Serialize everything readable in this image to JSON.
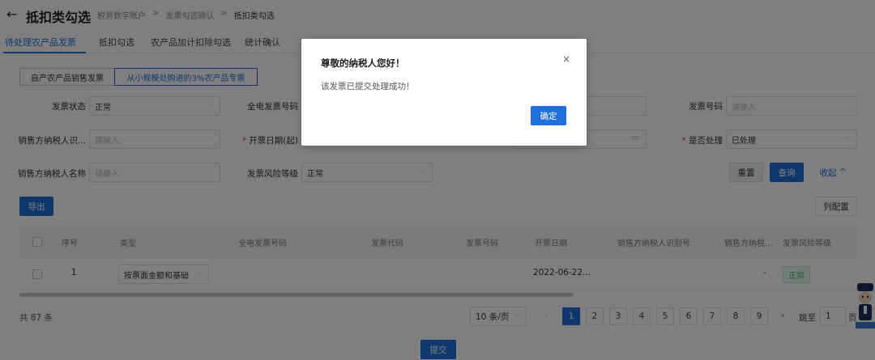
{
  "header": {
    "title": "抵扣类勾选",
    "breadcrumb": [
      "税务数字账户",
      ">",
      "发票勾选确认",
      ">",
      "抵扣类勾选"
    ]
  },
  "tabs": [
    "待处理农产品发票",
    "抵扣勾选",
    "农产品加计扣除勾选",
    "统计确认"
  ],
  "segments": [
    "自产农产品销售发票",
    "从小规模处购进的3%农产品专票"
  ],
  "filters": {
    "invoice_status_label": "发票状态",
    "invoice_status_value": "正常",
    "digital_no_label": "全电发票号码",
    "invoice_no_label": "发票号码",
    "invoice_no_placeholder": "请输入",
    "seller_tax_id_label": "销售方纳税人识...",
    "seller_tax_id_placeholder": "请输入",
    "issue_date_label": "开票日期(起)",
    "processed_label": "是否处理",
    "processed_value": "已处理",
    "seller_name_label": "销售方纳税人名称",
    "seller_name_placeholder": "请输入",
    "risk_label": "发票风险等级",
    "risk_value": "正常",
    "req_mark": "*"
  },
  "buttons": {
    "reset": "重置",
    "query": "查询",
    "collapse": "收起",
    "export": "导出",
    "columns": "列配置",
    "submit": "提交"
  },
  "table": {
    "headers": [
      "序号",
      "类型",
      "全电发票号码",
      "发票代码",
      "发票号码",
      "开票日期",
      "销售方纳税人识别号",
      "销售方纳税...",
      "发票风险等级"
    ],
    "rows": [
      {
        "index": "1",
        "type": "按票面金额和基础",
        "date": "2022-06-22...",
        "dash": "-",
        "risk": "正常"
      }
    ]
  },
  "pagination": {
    "total": "共 87 条",
    "page_size": "10 条/页",
    "pages": [
      "1",
      "2",
      "3",
      "4",
      "5",
      "6",
      "7",
      "8",
      "9"
    ],
    "current": "1",
    "jump_label": "跳至",
    "jump_value": "1",
    "page_suffix": "页"
  },
  "modal": {
    "title": "尊敬的纳税人您好！",
    "message": "该发票已提交处理成功！",
    "ok": "确定",
    "close": "×"
  },
  "icons": {
    "back": "←",
    "close": "×",
    "chevron_down": "⌵",
    "chevron_up": "^",
    "calendar": "▭",
    "prev": "‹",
    "next": "›"
  },
  "colors": {
    "primary": "#1e6fd9",
    "success": "#3bb56a",
    "required": "#e53935"
  }
}
